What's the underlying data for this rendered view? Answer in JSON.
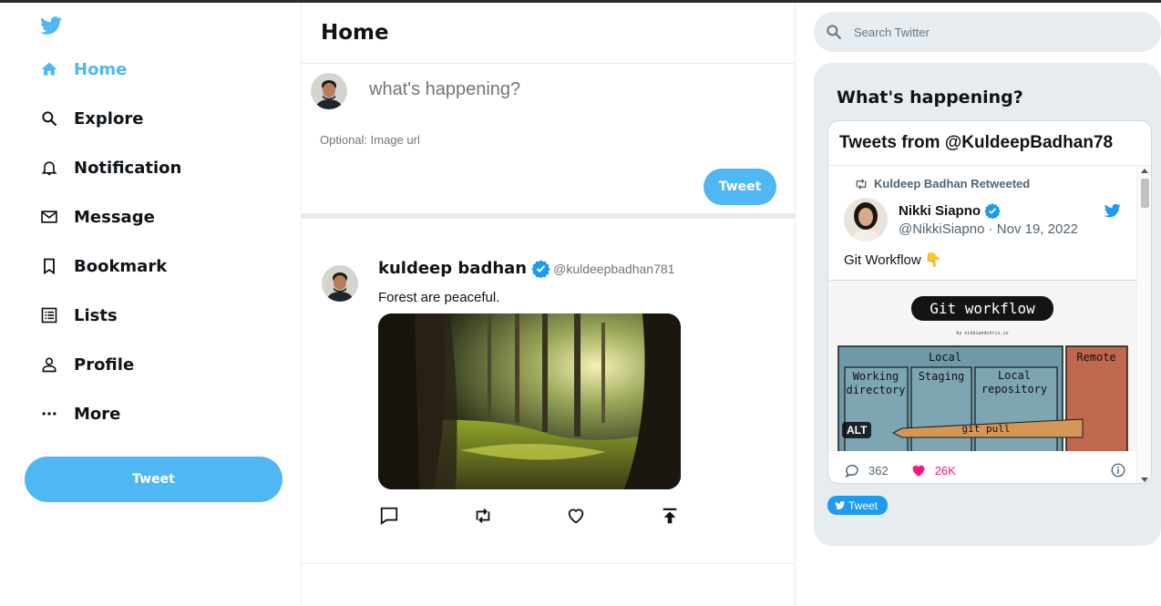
{
  "colors": {
    "accent": "#50b7f5",
    "twitter_blue": "#1d9bf0",
    "verified": "#1d9bf0",
    "like_pink": "#f91880",
    "border": "#e6ecf0",
    "muted": "#6e767d"
  },
  "sidebar": {
    "logo_icon": "twitter-bird-icon",
    "items": [
      {
        "label": "Home",
        "icon": "home-icon",
        "active": true
      },
      {
        "label": "Explore",
        "icon": "search-icon",
        "active": false
      },
      {
        "label": "Notification",
        "icon": "bell-icon",
        "active": false
      },
      {
        "label": "Message",
        "icon": "mail-icon",
        "active": false
      },
      {
        "label": "Bookmark",
        "icon": "bookmark-icon",
        "active": false
      },
      {
        "label": "Lists",
        "icon": "list-icon",
        "active": false
      },
      {
        "label": "Profile",
        "icon": "person-icon",
        "active": false
      },
      {
        "label": "More",
        "icon": "more-icon",
        "active": false
      }
    ],
    "tweet_button": "Tweet"
  },
  "feed": {
    "title": "Home",
    "tweetbox": {
      "placeholder": "what's happening?",
      "image_placeholder": "Optional: Image url",
      "button": "Tweet"
    },
    "post": {
      "display_name": "kuldeep badhan",
      "handle": "@kuldeepbadhan781",
      "verified": true,
      "text": "Forest are peaceful.",
      "image_alt": "forest",
      "actions": [
        "comment-icon",
        "retweet-icon",
        "like-icon",
        "share-icon"
      ]
    }
  },
  "widgets": {
    "search_placeholder": "Search Twitter",
    "panel_title": "What's happening?",
    "embed": {
      "title": "Tweets from @KuldeepBadhan78",
      "retweeted_by": "Kuldeep Badhan Retweeted",
      "author_name": "Nikki Siapno",
      "author_handle": "@NikkiSiapno",
      "separator": "·",
      "date": "Nov 19, 2022",
      "text": "Git Workflow 👇",
      "media": {
        "title": "Git workflow",
        "byline": "by nikkiandchris.io",
        "local": "Local",
        "remote": "Remote",
        "working_1": "Working",
        "working_2": "directory",
        "staging": "Staging",
        "local_repo_1": "Local",
        "local_repo_2": "repository",
        "git_pull": "git pull"
      },
      "alt_badge": "ALT",
      "replies": "362",
      "likes": "26K"
    },
    "follow_button": "Tweet"
  }
}
